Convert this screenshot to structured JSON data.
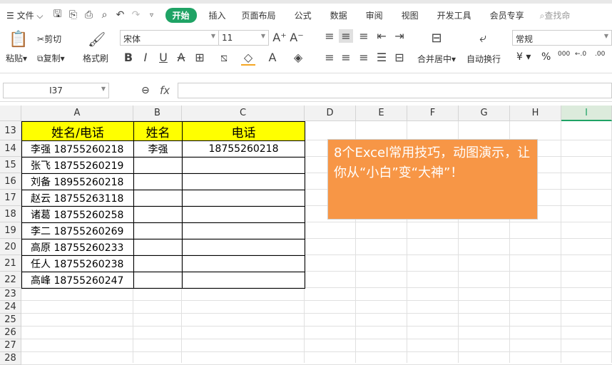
{
  "menu": {
    "file": "文件",
    "tabs": [
      "开始",
      "插入",
      "页面布局",
      "公式",
      "数据",
      "审阅",
      "视图",
      "开发工具",
      "会员专享"
    ],
    "search": "查找命"
  },
  "ribbon": {
    "paste": "粘贴",
    "cut": "剪切",
    "copy": "复制",
    "format_painter": "格式刷",
    "font": "宋体",
    "size": "11",
    "merge": "合并居中",
    "wrap": "自动换行",
    "number_format": "常规",
    "currency": "¥",
    "percent": "%",
    "thousands": "000",
    "inc_dec": "←.0",
    "dec_dec": ".00"
  },
  "formula_bar": {
    "name_box": "I37",
    "fx": "fx",
    "value": ""
  },
  "columns": [
    "A",
    "B",
    "C",
    "D",
    "E",
    "F",
    "G",
    "H",
    "I"
  ],
  "rows": [
    "13",
    "14",
    "15",
    "16",
    "17",
    "18",
    "19",
    "20",
    "21",
    "22",
    "23",
    "24",
    "25",
    "26",
    "27",
    "28"
  ],
  "table": {
    "headers": [
      "姓名/电话",
      "姓名",
      "电话"
    ],
    "rows": [
      [
        "李强 18755260218",
        "李强",
        "18755260218"
      ],
      [
        "张飞 18755260219",
        "",
        ""
      ],
      [
        "刘备 18955260218",
        "",
        ""
      ],
      [
        "赵云 18755263118",
        "",
        ""
      ],
      [
        "诸葛 18755260258",
        "",
        ""
      ],
      [
        "李二 18755260269",
        "",
        ""
      ],
      [
        "高原 18755260233",
        "",
        ""
      ],
      [
        "任人 18755260238",
        "",
        ""
      ],
      [
        "高峰 18755260247",
        "",
        ""
      ]
    ]
  },
  "textbox": "8个Excel常用技巧，动图演示，让你从“小白”变“大神”！",
  "colors": {
    "accent": "#1fa365",
    "header_fill": "#ffff00",
    "textbox_fill": "#f79646"
  }
}
